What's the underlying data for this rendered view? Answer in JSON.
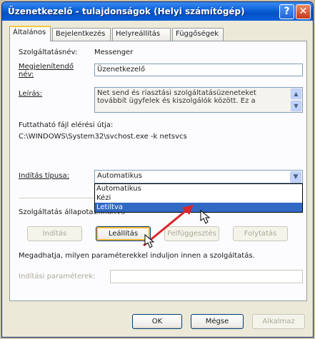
{
  "window": {
    "title": "Üzenetkezelő - tulajdonságok (Helyi számítógép)",
    "help_glyph": "?",
    "close_glyph": "✕"
  },
  "tabs": [
    "Általános",
    "Bejelentkezés",
    "Helyreállítás",
    "Függőségek"
  ],
  "general": {
    "service_name_label": "Szolgáltatásnév:",
    "service_name_value": "Messenger",
    "display_name_label": "Megjelenítendő név:",
    "display_name_value": "Üzenetkezelő",
    "description_label": "Leírás:",
    "description_value": "Net send és riasztási szolgáltatásüzeneteket továbbít ügyfelek és kiszolgálók között. Ez a",
    "exe_path_label": "Futtatható fájl elérési útja:",
    "exe_path_value": "C:\\WINDOWS\\System32\\svchost.exe -k netsvcs",
    "startup_type_label": "Indítás típusa:",
    "startup_type_value": "Automatikus",
    "startup_options": [
      "Automatikus",
      "Kézi",
      "Letiltva"
    ],
    "startup_selected_index": 2,
    "status_label": "Szolgáltatás állapota:",
    "status_value": "Elindítva",
    "buttons": {
      "start": "Indítás",
      "stop": "Leállítás",
      "pause": "Felfüggesztés",
      "resume": "Folytatás"
    },
    "params_hint": "Megadhatja, milyen paraméterekkel induljon innen a szolgáltatás.",
    "params_label": "Indítási paraméterek:",
    "params_value": ""
  },
  "footer": {
    "ok": "OK",
    "cancel": "Mégse",
    "apply": "Alkalmaz"
  },
  "colors": {
    "annotation_arrow": "#d9262c",
    "title_bar": "#0a5fd8"
  }
}
